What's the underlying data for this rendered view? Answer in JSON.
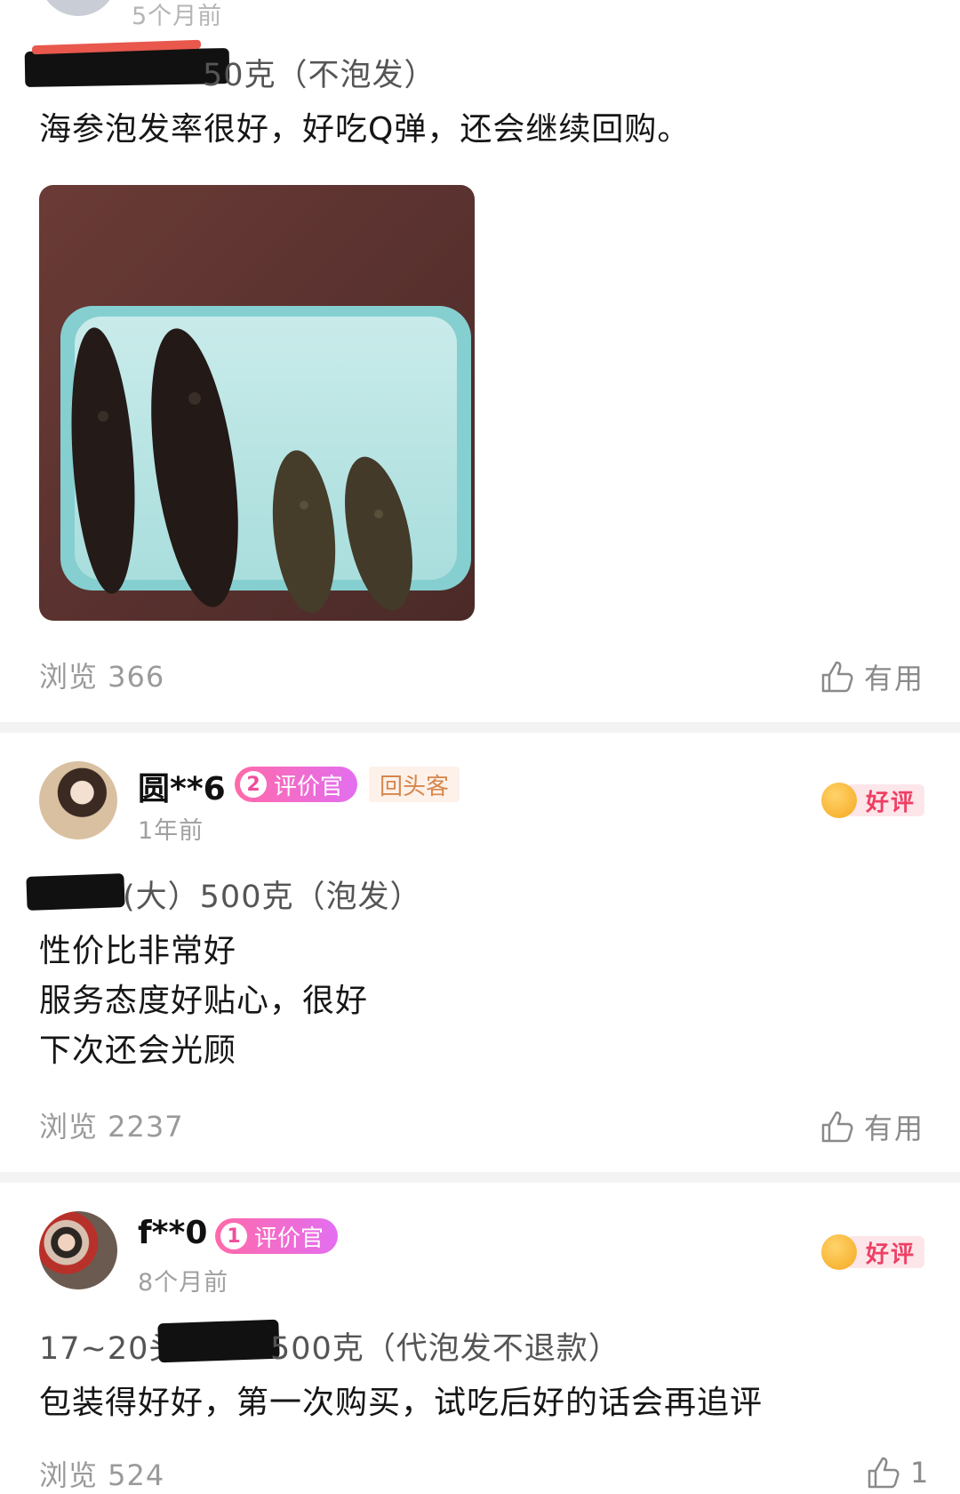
{
  "review1": {
    "time": "5个月前",
    "spec_visible": "50克（不泡发）",
    "content": "海参泡发率很好，好吃Q弹，还会继续回购。",
    "views": "浏览 366",
    "useful_label": "有用"
  },
  "review2": {
    "username": "圆**6",
    "badge_level": "2",
    "badge_label": "评价官",
    "return_badge": "回头客",
    "time": "1年前",
    "rating": "好评",
    "spec_visible": "(大）500克（泡发）",
    "content_lines": [
      "性价比非常好",
      " 服务态度好贴心，很好",
      "下次还会光顾"
    ],
    "views": "浏览 2237",
    "useful_label": "有用"
  },
  "review3": {
    "username": "f**0",
    "badge_level": "1",
    "badge_label": "评价官",
    "time": "8个月前",
    "rating": "好评",
    "spec_prefix": "17~20头",
    "spec_suffix": "500克（代泡发不退款）",
    "content": "包装得好好，第一次购买，试吃后好的话会再追评",
    "views": "浏览 524",
    "useful_count": "1"
  },
  "colors": {
    "accent_pink": "#ef3f64",
    "badge_gradient_start": "#ff6aa9",
    "badge_gradient_end": "#e36ef0",
    "return_badge_text": "#d6864c"
  },
  "icons": [
    "thumbs-up-icon",
    "smile-face-icon"
  ]
}
